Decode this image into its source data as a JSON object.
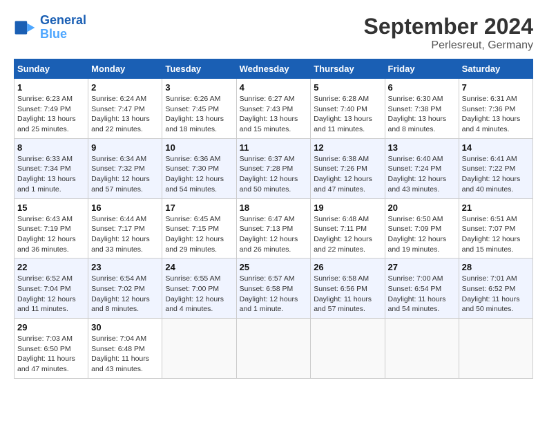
{
  "header": {
    "logo_line1": "General",
    "logo_line2": "Blue",
    "month_title": "September 2024",
    "location": "Perlesreut, Germany"
  },
  "weekdays": [
    "Sunday",
    "Monday",
    "Tuesday",
    "Wednesday",
    "Thursday",
    "Friday",
    "Saturday"
  ],
  "weeks": [
    [
      {
        "day": "1",
        "sunrise": "6:23 AM",
        "sunset": "7:49 PM",
        "daylight": "13 hours and 25 minutes."
      },
      {
        "day": "2",
        "sunrise": "6:24 AM",
        "sunset": "7:47 PM",
        "daylight": "13 hours and 22 minutes."
      },
      {
        "day": "3",
        "sunrise": "6:26 AM",
        "sunset": "7:45 PM",
        "daylight": "13 hours and 18 minutes."
      },
      {
        "day": "4",
        "sunrise": "6:27 AM",
        "sunset": "7:43 PM",
        "daylight": "13 hours and 15 minutes."
      },
      {
        "day": "5",
        "sunrise": "6:28 AM",
        "sunset": "7:40 PM",
        "daylight": "13 hours and 11 minutes."
      },
      {
        "day": "6",
        "sunrise": "6:30 AM",
        "sunset": "7:38 PM",
        "daylight": "13 hours and 8 minutes."
      },
      {
        "day": "7",
        "sunrise": "6:31 AM",
        "sunset": "7:36 PM",
        "daylight": "13 hours and 4 minutes."
      }
    ],
    [
      {
        "day": "8",
        "sunrise": "6:33 AM",
        "sunset": "7:34 PM",
        "daylight": "13 hours and 1 minute."
      },
      {
        "day": "9",
        "sunrise": "6:34 AM",
        "sunset": "7:32 PM",
        "daylight": "12 hours and 57 minutes."
      },
      {
        "day": "10",
        "sunrise": "6:36 AM",
        "sunset": "7:30 PM",
        "daylight": "12 hours and 54 minutes."
      },
      {
        "day": "11",
        "sunrise": "6:37 AM",
        "sunset": "7:28 PM",
        "daylight": "12 hours and 50 minutes."
      },
      {
        "day": "12",
        "sunrise": "6:38 AM",
        "sunset": "7:26 PM",
        "daylight": "12 hours and 47 minutes."
      },
      {
        "day": "13",
        "sunrise": "6:40 AM",
        "sunset": "7:24 PM",
        "daylight": "12 hours and 43 minutes."
      },
      {
        "day": "14",
        "sunrise": "6:41 AM",
        "sunset": "7:22 PM",
        "daylight": "12 hours and 40 minutes."
      }
    ],
    [
      {
        "day": "15",
        "sunrise": "6:43 AM",
        "sunset": "7:19 PM",
        "daylight": "12 hours and 36 minutes."
      },
      {
        "day": "16",
        "sunrise": "6:44 AM",
        "sunset": "7:17 PM",
        "daylight": "12 hours and 33 minutes."
      },
      {
        "day": "17",
        "sunrise": "6:45 AM",
        "sunset": "7:15 PM",
        "daylight": "12 hours and 29 minutes."
      },
      {
        "day": "18",
        "sunrise": "6:47 AM",
        "sunset": "7:13 PM",
        "daylight": "12 hours and 26 minutes."
      },
      {
        "day": "19",
        "sunrise": "6:48 AM",
        "sunset": "7:11 PM",
        "daylight": "12 hours and 22 minutes."
      },
      {
        "day": "20",
        "sunrise": "6:50 AM",
        "sunset": "7:09 PM",
        "daylight": "12 hours and 19 minutes."
      },
      {
        "day": "21",
        "sunrise": "6:51 AM",
        "sunset": "7:07 PM",
        "daylight": "12 hours and 15 minutes."
      }
    ],
    [
      {
        "day": "22",
        "sunrise": "6:52 AM",
        "sunset": "7:04 PM",
        "daylight": "12 hours and 11 minutes."
      },
      {
        "day": "23",
        "sunrise": "6:54 AM",
        "sunset": "7:02 PM",
        "daylight": "12 hours and 8 minutes."
      },
      {
        "day": "24",
        "sunrise": "6:55 AM",
        "sunset": "7:00 PM",
        "daylight": "12 hours and 4 minutes."
      },
      {
        "day": "25",
        "sunrise": "6:57 AM",
        "sunset": "6:58 PM",
        "daylight": "12 hours and 1 minute."
      },
      {
        "day": "26",
        "sunrise": "6:58 AM",
        "sunset": "6:56 PM",
        "daylight": "11 hours and 57 minutes."
      },
      {
        "day": "27",
        "sunrise": "7:00 AM",
        "sunset": "6:54 PM",
        "daylight": "11 hours and 54 minutes."
      },
      {
        "day": "28",
        "sunrise": "7:01 AM",
        "sunset": "6:52 PM",
        "daylight": "11 hours and 50 minutes."
      }
    ],
    [
      {
        "day": "29",
        "sunrise": "7:03 AM",
        "sunset": "6:50 PM",
        "daylight": "11 hours and 47 minutes."
      },
      {
        "day": "30",
        "sunrise": "7:04 AM",
        "sunset": "6:48 PM",
        "daylight": "11 hours and 43 minutes."
      },
      null,
      null,
      null,
      null,
      null
    ]
  ]
}
